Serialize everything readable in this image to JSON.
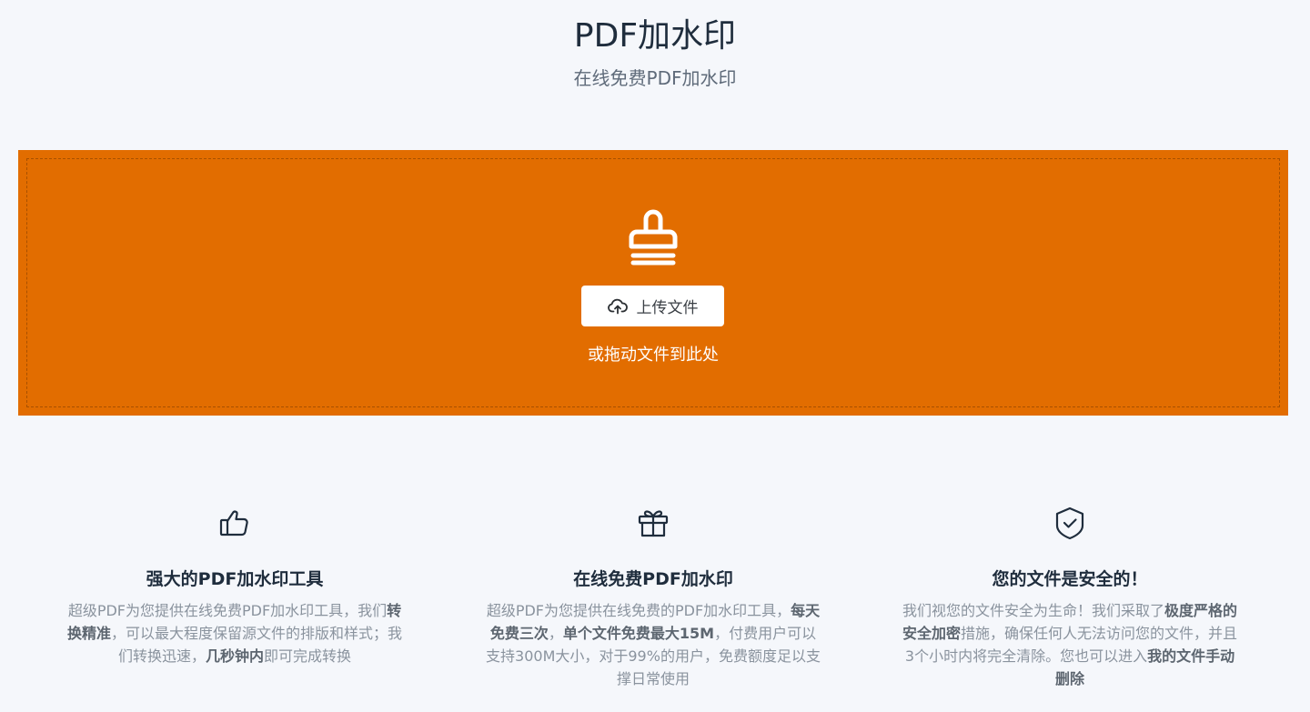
{
  "header": {
    "title": "PDF加水印",
    "subtitle": "在线免费PDF加水印"
  },
  "upload": {
    "icon": "stamp-icon",
    "button_icon": "cloud-upload-icon",
    "button_label": "上传文件",
    "drag_hint": "或拖动文件到此处",
    "background_color": "#e26d00"
  },
  "features": [
    {
      "icon": "thumbs-up-icon",
      "title": "强大的PDF加水印工具",
      "desc": [
        {
          "text": "超级PDF为您提供在线免费PDF加水印工具，我们",
          "bold": false
        },
        {
          "text": "转换精准",
          "bold": true
        },
        {
          "text": "，可以最大程度保留源文件的排版和样式；我们转换迅速，",
          "bold": false
        },
        {
          "text": "几秒钟内",
          "bold": true
        },
        {
          "text": "即可完成转换",
          "bold": false
        }
      ]
    },
    {
      "icon": "gift-icon",
      "title": "在线免费PDF加水印",
      "desc": [
        {
          "text": "超级PDF为您提供在线免费的PDF加水印工具，",
          "bold": false
        },
        {
          "text": "每天免费三次",
          "bold": true
        },
        {
          "text": "，",
          "bold": false
        },
        {
          "text": "单个文件免费最大15M",
          "bold": true
        },
        {
          "text": "，付费用户可以支持300M大小，对于99%的用户，免费额度足以支撑日常使用",
          "bold": false
        }
      ]
    },
    {
      "icon": "shield-check-icon",
      "title": "您的文件是安全的！",
      "desc": [
        {
          "text": "我们视您的文件安全为生命！我们采取了",
          "bold": false
        },
        {
          "text": "极度严格的安全加密",
          "bold": true
        },
        {
          "text": "措施，确保任何人无法访问您的文件，并且3个小时内将完全清除。您也可以进入",
          "bold": false
        },
        {
          "text": "我的文件手动删除",
          "bold": true
        }
      ]
    }
  ]
}
